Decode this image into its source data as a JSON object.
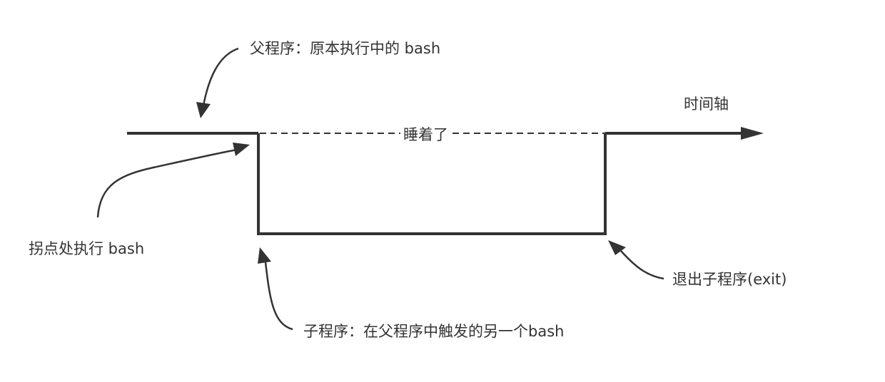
{
  "labels": {
    "parent_process": "父程序：原本执行中的 bash",
    "time_axis": "时间轴",
    "sleeping": "睡着了",
    "fork_point": "拐点处执行 bash",
    "exit_child": "退出子程序(exit)",
    "child_process": "子程序：在父程序中触发的另一个bash"
  },
  "colors": {
    "line": "#333333",
    "background": "#ffffff"
  }
}
